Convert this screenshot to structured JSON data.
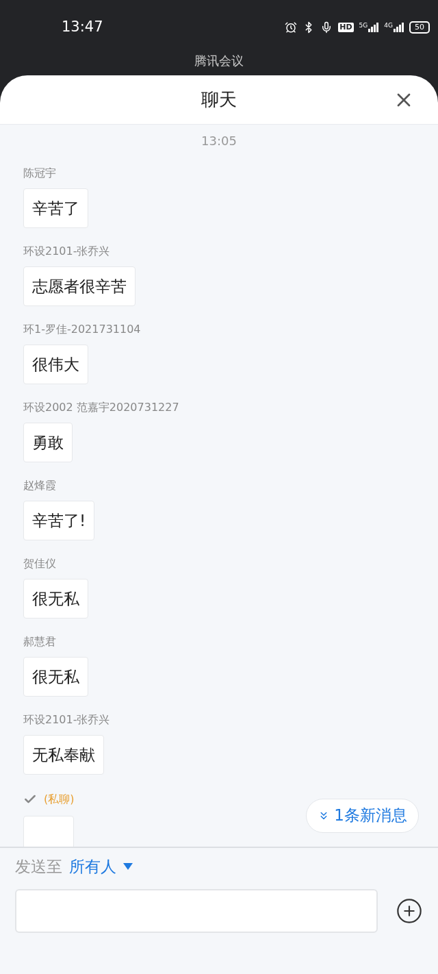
{
  "status_bar": {
    "time": "13:47",
    "hd": "HD",
    "network_1": "5G",
    "network_2": "4G",
    "battery": "50"
  },
  "app_title": "腾讯会议",
  "sheet": {
    "title": "聊天"
  },
  "timestamp": "13:05",
  "messages": [
    {
      "sender": "陈冠宇",
      "text": "辛苦了"
    },
    {
      "sender": "环设2101-张乔兴",
      "text": "志愿者很辛苦"
    },
    {
      "sender": "环1-罗佳-2021731104",
      "text": "很伟大"
    },
    {
      "sender": "环设2002 范嘉宇2020731227",
      "text": "勇敢"
    },
    {
      "sender": "赵烽霞",
      "text": "辛苦了!"
    },
    {
      "sender": "贺佳仪",
      "text": "很无私"
    },
    {
      "sender": "郝慧君",
      "text": "很无私"
    },
    {
      "sender": "环设2101-张乔兴",
      "text": "无私奉献"
    }
  ],
  "private_message": {
    "tag": "(私聊)"
  },
  "new_messages_button": "1条新消息",
  "send_to": {
    "label": "发送至",
    "target": "所有人"
  }
}
